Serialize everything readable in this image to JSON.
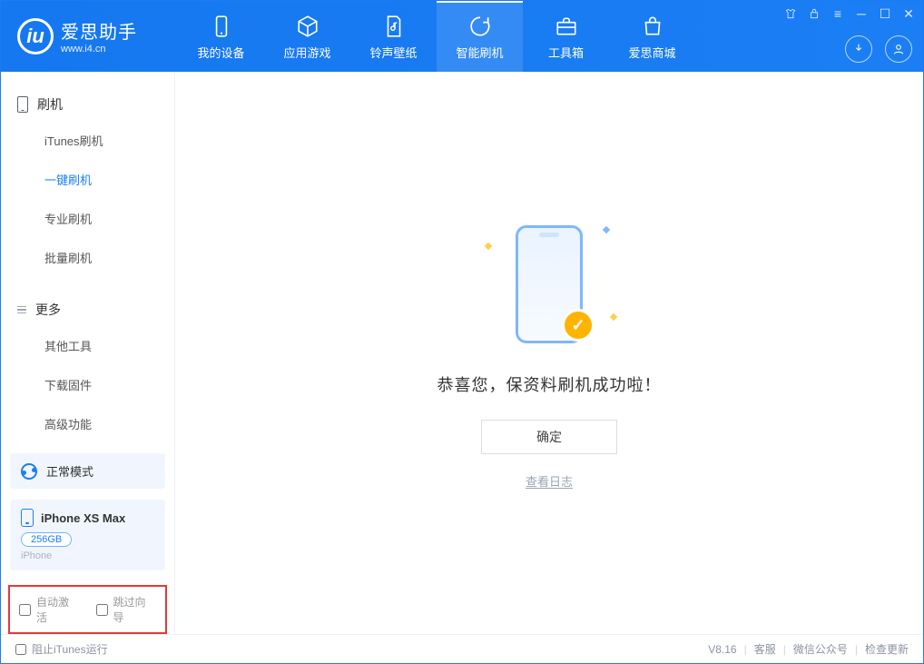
{
  "app": {
    "name": "爱思助手",
    "url": "www.i4.cn"
  },
  "nav": {
    "my_device": "我的设备",
    "apps_games": "应用游戏",
    "ring_wall": "铃声壁纸",
    "smart_flash": "智能刷机",
    "toolbox": "工具箱",
    "store": "爱思商城"
  },
  "sidebar": {
    "section_flash_title": "刷机",
    "items": {
      "itunes": "iTunes刷机",
      "oneclick": "一键刷机",
      "pro": "专业刷机",
      "batch": "批量刷机"
    },
    "section_more_title": "更多",
    "more": {
      "other_tools": "其他工具",
      "download_fw": "下载固件",
      "advanced": "高级功能"
    }
  },
  "mode_label": "正常模式",
  "device": {
    "name": "iPhone XS Max",
    "storage": "256GB",
    "type": "iPhone"
  },
  "options": {
    "auto_activate": "自动激活",
    "skip_guide": "跳过向导"
  },
  "main": {
    "success_msg": "恭喜您，保资料刷机成功啦！",
    "ok": "确定",
    "view_log": "查看日志"
  },
  "footer": {
    "block_itunes": "阻止iTunes运行",
    "version": "V8.16",
    "support": "客服",
    "wechat": "微信公众号",
    "check_update": "检查更新"
  }
}
